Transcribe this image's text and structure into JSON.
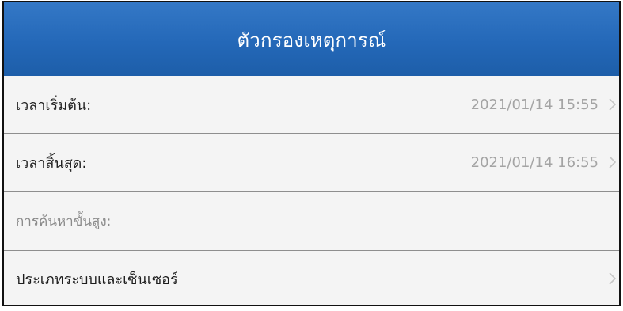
{
  "header": {
    "title": "ตัวกรองเหตุการณ์"
  },
  "rows": [
    {
      "label": "เวลาเริ่มต้น:",
      "value": "2021/01/14 15:55",
      "icon": "chevron-right-icon"
    },
    {
      "label": "เวลาสิ้นสุด:",
      "value": "2021/01/14 16:55",
      "icon": "chevron-right-icon"
    }
  ],
  "section": {
    "label": "การค้นหาขั้นสูง:"
  },
  "system_row": {
    "label": "ประเภทระบบและเซ็นเซอร์",
    "icon": "chevron-right-icon"
  },
  "colors": {
    "header_bg": "#2468b8",
    "header_text": "#ffffff",
    "row_bg": "#f4f4f4",
    "value_text": "#a4a4a4",
    "divider": "#8e8e8e"
  }
}
